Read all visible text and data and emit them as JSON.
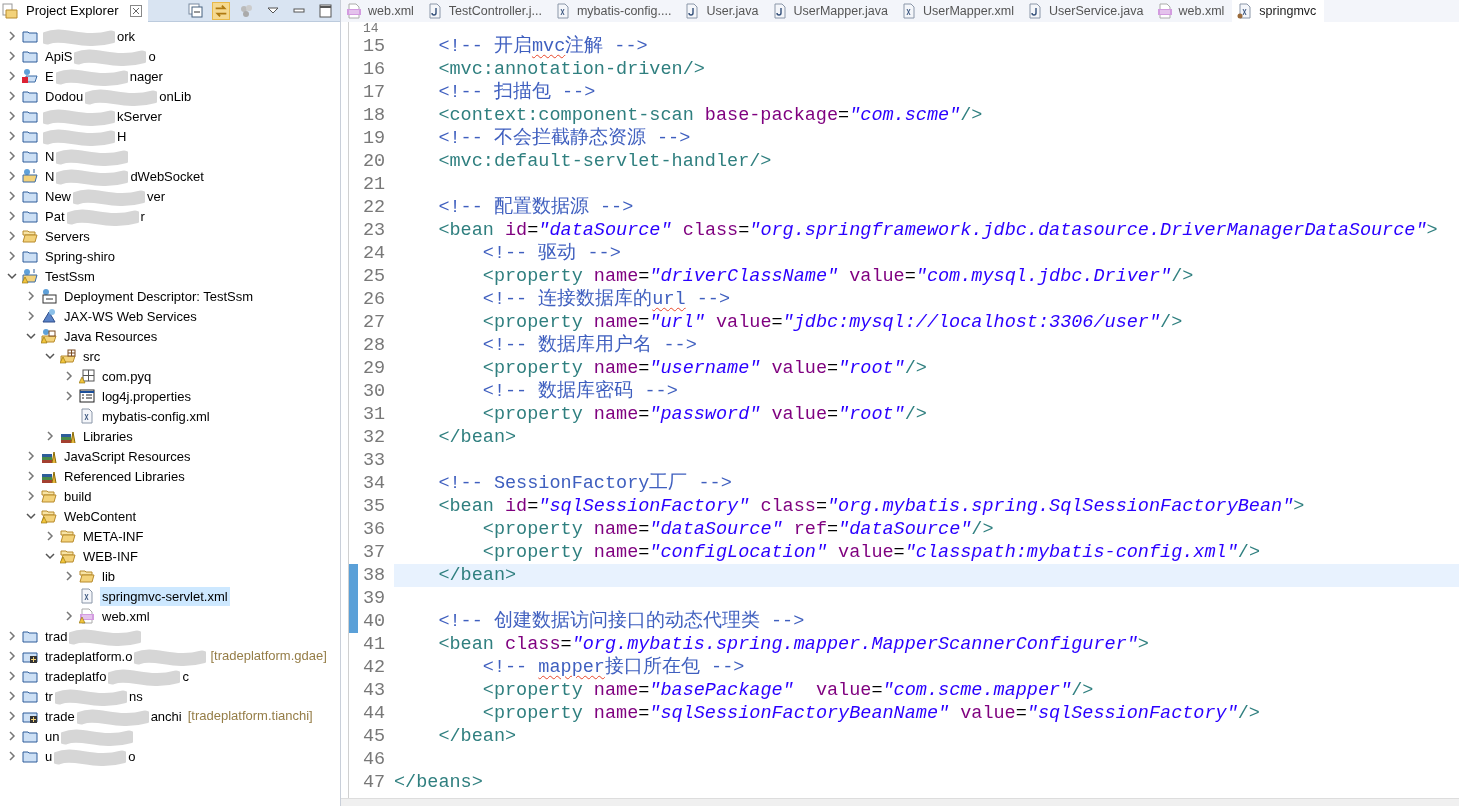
{
  "explorer": {
    "title": "Project Explorer",
    "tree": [
      {
        "label_end": "ork",
        "redacted": true,
        "kind": "project",
        "expanded": false,
        "selected": false,
        "warning": false
      },
      {
        "label_start": "ApiS",
        "label_end": "o",
        "redacted": true,
        "kind": "project",
        "expanded": false,
        "selected": false,
        "warning": false
      },
      {
        "label_start": "E",
        "label_end": "nager",
        "redacted": true,
        "kind": "web-project-error",
        "expanded": false,
        "selected": false,
        "warning": false
      },
      {
        "label_start": "Dodou",
        "label_end": "onLib",
        "redacted": true,
        "kind": "project",
        "expanded": false,
        "selected": false,
        "warning": false
      },
      {
        "label_end": "kServer",
        "redacted": true,
        "kind": "project",
        "expanded": false,
        "selected": false,
        "warning": false
      },
      {
        "label_end": "H",
        "redacted": true,
        "kind": "project",
        "expanded": false,
        "selected": false,
        "warning": false
      },
      {
        "label_start": "N",
        "redacted": true,
        "kind": "project",
        "expanded": false,
        "selected": false,
        "warning": false
      },
      {
        "label_start": "N",
        "label_end": "dWebSocket",
        "redacted": true,
        "kind": "web-project",
        "expanded": false,
        "selected": false,
        "warning": false
      },
      {
        "label_start": "New",
        "label_end": "ver",
        "redacted": true,
        "kind": "project",
        "expanded": false,
        "selected": false,
        "warning": false
      },
      {
        "label_start": "Pat",
        "label_end": "r",
        "redacted": true,
        "kind": "project",
        "expanded": false,
        "selected": false,
        "warning": false
      },
      {
        "label_start": "Servers",
        "redacted": false,
        "kind": "open-folder",
        "expanded": false,
        "selected": false,
        "warning": false
      },
      {
        "label_start": "Spring-shiro",
        "redacted": false,
        "kind": "project",
        "expanded": false,
        "selected": false,
        "warning": false
      },
      {
        "label_start": "TestSsm",
        "redacted": false,
        "kind": "web-project",
        "expanded": true,
        "selected": false,
        "warning": true,
        "children": [
          {
            "label_start": "Deployment Descriptor: TestSsm",
            "redacted": false,
            "kind": "descriptor",
            "expanded": false,
            "selected": false,
            "warning": false
          },
          {
            "label_start": "JAX-WS Web Services",
            "redacted": false,
            "kind": "webservices",
            "expanded": false,
            "selected": false,
            "warning": false
          },
          {
            "label_start": "Java Resources",
            "redacted": false,
            "kind": "java-resources",
            "expanded": true,
            "selected": false,
            "warning": true,
            "children": [
              {
                "label_start": "src",
                "redacted": false,
                "kind": "source-folder",
                "expanded": true,
                "selected": false,
                "warning": true,
                "children": [
                  {
                    "label_start": "com.pyq",
                    "redacted": false,
                    "kind": "package",
                    "expanded": false,
                    "selected": false,
                    "warning": true
                  },
                  {
                    "label_start": "log4j.properties",
                    "redacted": false,
                    "kind": "properties",
                    "expanded": false,
                    "selected": false,
                    "warning": false
                  },
                  {
                    "label_start": "mybatis-config.xml",
                    "redacted": false,
                    "kind": "xml",
                    "selected": false,
                    "warning": false
                  }
                ]
              },
              {
                "label_start": "Libraries",
                "redacted": false,
                "kind": "library",
                "expanded": false,
                "selected": false,
                "warning": false
              }
            ]
          },
          {
            "label_start": "JavaScript Resources",
            "redacted": false,
            "kind": "library",
            "expanded": false,
            "selected": false,
            "warning": false
          },
          {
            "label_start": "Referenced Libraries",
            "redacted": false,
            "kind": "library",
            "expanded": false,
            "selected": false,
            "warning": false
          },
          {
            "label_start": "build",
            "redacted": false,
            "kind": "open-folder",
            "expanded": false,
            "selected": false,
            "warning": false
          },
          {
            "label_start": "WebContent",
            "redacted": false,
            "kind": "open-folder",
            "expanded": true,
            "selected": false,
            "warning": true,
            "children": [
              {
                "label_start": "META-INF",
                "redacted": false,
                "kind": "open-folder",
                "expanded": false,
                "selected": false,
                "warning": false
              },
              {
                "label_start": "WEB-INF",
                "redacted": false,
                "kind": "open-folder",
                "expanded": true,
                "selected": false,
                "warning": true,
                "children": [
                  {
                    "label_start": "lib",
                    "redacted": false,
                    "kind": "open-folder",
                    "expanded": false,
                    "selected": false,
                    "warning": false
                  },
                  {
                    "label_start": "springmvc-servlet.xml",
                    "redacted": false,
                    "kind": "xml",
                    "selected": true,
                    "warning": false
                  },
                  {
                    "label_start": "web.xml",
                    "redacted": false,
                    "kind": "web-xml",
                    "expanded": false,
                    "selected": false,
                    "warning": true
                  }
                ]
              }
            ]
          }
        ]
      },
      {
        "label_start": "trad",
        "redacted": true,
        "kind": "project",
        "expanded": false,
        "selected": false,
        "warning": false
      },
      {
        "label_start": "tradeplatform.o",
        "redacted": true,
        "decoration": "[tradeplatform.gdae]",
        "kind": "maven-project",
        "expanded": false,
        "selected": false,
        "warning": false
      },
      {
        "label_start": "tradeplatfo",
        "label_end": "c",
        "redacted": true,
        "kind": "project",
        "expanded": false,
        "selected": false,
        "warning": false
      },
      {
        "label_start": "tr",
        "label_end": "ns",
        "redacted": true,
        "kind": "project",
        "expanded": false,
        "selected": false,
        "warning": false
      },
      {
        "label_start": "trade",
        "label_end": "anchi",
        "redacted": true,
        "decoration": "[tradeplatform.tianchi]",
        "kind": "maven-project",
        "expanded": false,
        "selected": false,
        "warning": false
      },
      {
        "label_start": "un",
        "redacted": true,
        "kind": "project",
        "expanded": false,
        "selected": false,
        "warning": false
      },
      {
        "label_start": "u",
        "label_end": "o",
        "redacted": true,
        "kind": "project",
        "expanded": false,
        "selected": false,
        "warning": false
      }
    ]
  },
  "editor": {
    "tabs": [
      {
        "label": "web.xml",
        "kind": "web-xml",
        "selected": false
      },
      {
        "label": "TestController.j...",
        "kind": "java",
        "selected": false
      },
      {
        "label": "mybatis-config....",
        "kind": "xml",
        "selected": false
      },
      {
        "label": "User.java",
        "kind": "java",
        "selected": false
      },
      {
        "label": "UserMapper.java",
        "kind": "java",
        "selected": false
      },
      {
        "label": "UserMapper.xml",
        "kind": "xml",
        "selected": false
      },
      {
        "label": "UserService.java",
        "kind": "java",
        "selected": false
      },
      {
        "label": "web.xml",
        "kind": "web-xml",
        "selected": false
      },
      {
        "label": "springmvc",
        "kind": "xml-mod",
        "selected": true
      }
    ],
    "lines": [
      {
        "number": "14",
        "kind": "root",
        "current": false,
        "changed": false
      },
      {
        "number": "15",
        "kind": "child",
        "current": false,
        "changed": false,
        "tokens": [
          {
            "kind": "comment",
            "text": "<!-- 开启"
          },
          {
            "kind": "misspelled",
            "text": "mvc"
          },
          {
            "kind": "comment",
            "text": "注解 -->"
          }
        ]
      },
      {
        "number": "16",
        "kind": "child",
        "current": false,
        "changed": false,
        "tokens": [
          {
            "kind": "tag",
            "text": "<mvc:annotation-driven/>"
          }
        ]
      },
      {
        "number": "17",
        "kind": "child",
        "current": false,
        "changed": false,
        "tokens": [
          {
            "kind": "comment",
            "text": "<!-- 扫描包 -->"
          }
        ]
      },
      {
        "number": "18",
        "kind": "child",
        "current": false,
        "changed": false,
        "tokens": [
          {
            "kind": "tag",
            "text": "<context:component-scan"
          },
          {
            "kind": "attr",
            "text": "base-package"
          },
          {
            "kind": "equals",
            "text": "="
          },
          {
            "kind": "value",
            "text": "\"com.scme\""
          },
          {
            "kind": "tag",
            "text": "/>"
          }
        ]
      },
      {
        "number": "19",
        "kind": "child",
        "current": false,
        "changed": false,
        "tokens": [
          {
            "kind": "comment",
            "text": "<!-- 不会拦截静态资源 -->"
          }
        ]
      },
      {
        "number": "20",
        "kind": "child",
        "current": false,
        "changed": false,
        "tokens": [
          {
            "kind": "tag",
            "text": "<mvc:default-servlet-handler/>"
          }
        ]
      },
      {
        "number": "21",
        "kind": "root",
        "current": false,
        "changed": false
      },
      {
        "number": "22",
        "kind": "child",
        "current": false,
        "changed": false,
        "tokens": [
          {
            "kind": "comment",
            "text": "<!-- 配置数据源 -->"
          }
        ]
      },
      {
        "number": "23",
        "kind": "child",
        "current": false,
        "changed": false,
        "tokens": [
          {
            "kind": "tag",
            "text": "<bean"
          },
          {
            "kind": "attr",
            "text": "id"
          },
          {
            "kind": "equals",
            "text": "="
          },
          {
            "kind": "value",
            "text": "\"dataSource\""
          },
          {
            "kind": "attr",
            "text": "class"
          },
          {
            "kind": "equals",
            "text": "="
          },
          {
            "kind": "value",
            "text": "\"org.springframework.jdbc.datasource.DriverManagerDataSource\""
          },
          {
            "kind": "tag",
            "text": ">"
          }
        ]
      },
      {
        "number": "24",
        "kind": "grandchild",
        "current": false,
        "changed": false,
        "tokens": [
          {
            "kind": "comment",
            "text": "<!-- 驱动 -->"
          }
        ]
      },
      {
        "number": "25",
        "kind": "grandchild",
        "current": false,
        "changed": false,
        "tokens": [
          {
            "kind": "tag",
            "text": "<property"
          },
          {
            "kind": "attr",
            "text": "name"
          },
          {
            "kind": "equals",
            "text": "="
          },
          {
            "kind": "value",
            "text": "\"driverClassName\""
          },
          {
            "kind": "attr",
            "text": "value"
          },
          {
            "kind": "equals",
            "text": "="
          },
          {
            "kind": "value",
            "text": "\"com.mysql.jdbc.Driver\""
          },
          {
            "kind": "tag",
            "text": "/>"
          }
        ]
      },
      {
        "number": "26",
        "kind": "grandchild",
        "current": false,
        "changed": false,
        "tokens": [
          {
            "kind": "comment",
            "text": "<!-- 连接数据库的"
          },
          {
            "kind": "misspelled",
            "text": "url"
          },
          {
            "kind": "comment_spaced",
            "text": "-->"
          }
        ]
      },
      {
        "number": "27",
        "kind": "grandchild",
        "current": false,
        "changed": false,
        "tokens": [
          {
            "kind": "tag",
            "text": "<property"
          },
          {
            "kind": "attr",
            "text": "name"
          },
          {
            "kind": "equals",
            "text": "="
          },
          {
            "kind": "value",
            "text": "\"url\""
          },
          {
            "kind": "attr",
            "text": "value"
          },
          {
            "kind": "equals",
            "text": "="
          },
          {
            "kind": "value",
            "text": "\"jdbc:mysql://localhost:3306/user\""
          },
          {
            "kind": "tag",
            "text": "/>"
          }
        ]
      },
      {
        "number": "28",
        "kind": "grandchild",
        "current": false,
        "changed": false,
        "tokens": [
          {
            "kind": "comment",
            "text": "<!-- 数据库用户名 -->"
          }
        ]
      },
      {
        "number": "29",
        "kind": "grandchild",
        "current": false,
        "changed": false,
        "tokens": [
          {
            "kind": "tag",
            "text": "<property"
          },
          {
            "kind": "attr",
            "text": "name"
          },
          {
            "kind": "equals",
            "text": "="
          },
          {
            "kind": "value",
            "text": "\"username\""
          },
          {
            "kind": "attr",
            "text": "value"
          },
          {
            "kind": "equals",
            "text": "="
          },
          {
            "kind": "value",
            "text": "\"root\""
          },
          {
            "kind": "tag",
            "text": "/>"
          }
        ]
      },
      {
        "number": "30",
        "kind": "grandchild",
        "current": false,
        "changed": false,
        "tokens": [
          {
            "kind": "comment",
            "text": "<!-- 数据库密码 -->"
          }
        ]
      },
      {
        "number": "31",
        "kind": "grandchild",
        "current": false,
        "changed": false,
        "tokens": [
          {
            "kind": "tag",
            "text": "<property"
          },
          {
            "kind": "attr",
            "text": "name"
          },
          {
            "kind": "equals",
            "text": "="
          },
          {
            "kind": "value",
            "text": "\"password\""
          },
          {
            "kind": "attr",
            "text": "value"
          },
          {
            "kind": "equals",
            "text": "="
          },
          {
            "kind": "value",
            "text": "\"root\""
          },
          {
            "kind": "tag",
            "text": "/>"
          }
        ]
      },
      {
        "number": "32",
        "kind": "child",
        "current": false,
        "changed": false,
        "tokens": [
          {
            "kind": "tag",
            "text": "</bean>"
          }
        ]
      },
      {
        "number": "33",
        "kind": "root",
        "current": false,
        "changed": false
      },
      {
        "number": "34",
        "kind": "child",
        "current": false,
        "changed": false,
        "tokens": [
          {
            "kind": "comment",
            "text": "<!-- SessionFactory工厂 -->"
          }
        ]
      },
      {
        "number": "35",
        "kind": "child",
        "current": false,
        "changed": false,
        "tokens": [
          {
            "kind": "tag",
            "text": "<bean"
          },
          {
            "kind": "attr",
            "text": "id"
          },
          {
            "kind": "equals",
            "text": "="
          },
          {
            "kind": "value",
            "text": "\"sqlSessionFactory\""
          },
          {
            "kind": "attr",
            "text": "class"
          },
          {
            "kind": "equals",
            "text": "="
          },
          {
            "kind": "value",
            "text": "\"org.mybatis.spring.SqlSessionFactoryBean\""
          },
          {
            "kind": "tag",
            "text": ">"
          }
        ]
      },
      {
        "number": "36",
        "kind": "grandchild",
        "current": false,
        "changed": false,
        "tokens": [
          {
            "kind": "tag",
            "text": "<property"
          },
          {
            "kind": "attr",
            "text": "name"
          },
          {
            "kind": "equals",
            "text": "="
          },
          {
            "kind": "value",
            "text": "\"dataSource\""
          },
          {
            "kind": "attr",
            "text": "ref"
          },
          {
            "kind": "equals",
            "text": "="
          },
          {
            "kind": "value",
            "text": "\"dataSource\""
          },
          {
            "kind": "tag",
            "text": "/>"
          }
        ]
      },
      {
        "number": "37",
        "kind": "grandchild",
        "current": false,
        "changed": false,
        "tokens": [
          {
            "kind": "tag",
            "text": "<property"
          },
          {
            "kind": "attr",
            "text": "name"
          },
          {
            "kind": "equals",
            "text": "="
          },
          {
            "kind": "value",
            "text": "\"configLocation\""
          },
          {
            "kind": "attr",
            "text": "value"
          },
          {
            "kind": "equals",
            "text": "="
          },
          {
            "kind": "value",
            "text": "\"classpath:mybatis-config.xml\""
          },
          {
            "kind": "tag",
            "text": "/>"
          }
        ]
      },
      {
        "number": "38",
        "kind": "child",
        "current": true,
        "changed": true,
        "tokens": [
          {
            "kind": "tag",
            "text": "</bean>"
          }
        ]
      },
      {
        "number": "39",
        "kind": "root",
        "current": false,
        "changed": true
      },
      {
        "number": "40",
        "kind": "child",
        "current": false,
        "changed": true,
        "tokens": [
          {
            "kind": "comment",
            "text": "<!-- 创建数据访问接口的动态代理类 -->"
          }
        ]
      },
      {
        "number": "41",
        "kind": "child",
        "current": false,
        "changed": false,
        "tokens": [
          {
            "kind": "tag",
            "text": "<bean"
          },
          {
            "kind": "attr",
            "text": "class"
          },
          {
            "kind": "equals",
            "text": "="
          },
          {
            "kind": "value",
            "text": "\"org.mybatis.spring.mapper.MapperScannerConfigurer\""
          },
          {
            "kind": "tag",
            "text": ">"
          }
        ]
      },
      {
        "number": "42",
        "kind": "grandchild",
        "current": false,
        "changed": false,
        "tokens": [
          {
            "kind": "comment",
            "text": "<!--"
          },
          {
            "kind": "misspelled_spaced",
            "text": "mapper"
          },
          {
            "kind": "comment",
            "text": "接口所在包 -->"
          }
        ]
      },
      {
        "number": "43",
        "kind": "grandchild",
        "current": false,
        "changed": false,
        "tokens": [
          {
            "kind": "tag",
            "text": "<property"
          },
          {
            "kind": "attr",
            "text": "name"
          },
          {
            "kind": "equals",
            "text": "="
          },
          {
            "kind": "value",
            "text": "\"basePackage\""
          },
          {
            "kind": "attr_wide",
            "text": "value"
          },
          {
            "kind": "equals",
            "text": "="
          },
          {
            "kind": "value",
            "text": "\"com.scme.mapper\""
          },
          {
            "kind": "tag",
            "text": "/>"
          }
        ]
      },
      {
        "number": "44",
        "kind": "grandchild",
        "current": false,
        "changed": false,
        "tokens": [
          {
            "kind": "tag",
            "text": "<property"
          },
          {
            "kind": "attr",
            "text": "name"
          },
          {
            "kind": "equals",
            "text": "="
          },
          {
            "kind": "value",
            "text": "\"sqlSessionFactoryBeanName\""
          },
          {
            "kind": "attr",
            "text": "value"
          },
          {
            "kind": "equals",
            "text": "="
          },
          {
            "kind": "value",
            "text": "\"sqlSessionFactory\""
          },
          {
            "kind": "tag",
            "text": "/>"
          }
        ]
      },
      {
        "number": "45",
        "kind": "child",
        "current": false,
        "changed": false,
        "tokens": [
          {
            "kind": "tag",
            "text": "</bean>"
          }
        ]
      },
      {
        "number": "46",
        "kind": "root",
        "current": false,
        "changed": false
      },
      {
        "number": "47",
        "kind": "root",
        "current": false,
        "changed": false,
        "tokens": [
          {
            "kind": "tag",
            "text": "</beans>"
          }
        ]
      }
    ]
  }
}
